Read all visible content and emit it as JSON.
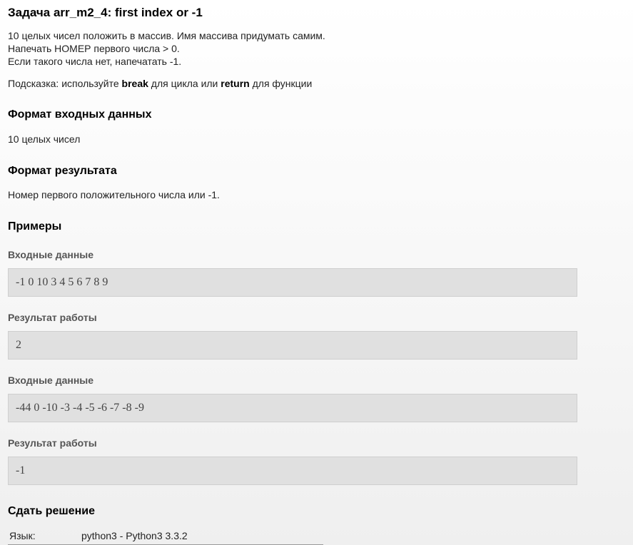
{
  "task": {
    "title": "Задача arr_m2_4: first index or -1",
    "statement_lines": [
      "10 целых чисел положить в массив. Имя массива придумать самим.",
      "Напечать НОМЕР первого числа > 0.",
      "Если такого числа нет, напечатать -1."
    ],
    "hint": {
      "prefix": "Подсказка: используйте ",
      "keyword1": "break",
      "middle": " для цикла или ",
      "keyword2": "return",
      "suffix": " для функции"
    }
  },
  "input_format": {
    "title": "Формат входных данных",
    "text": "10 целых чисел"
  },
  "output_format": {
    "title": "Формат результата",
    "text": "Номер первого положительного числа или -1."
  },
  "examples": {
    "title": "Примеры",
    "items": [
      {
        "input_label": "Входные данные",
        "input": "-1 0 10 3 4 5 6 7 8 9",
        "output_label": "Результат работы",
        "output": "2"
      },
      {
        "input_label": "Входные данные",
        "input": "-44 0 -10 -3 -4 -5 -6 -7 -8 -9",
        "output_label": "Результат работы",
        "output": "-1"
      }
    ]
  },
  "submit": {
    "title": "Сдать решение",
    "language_label": "Язык:",
    "language_value": "python3 - Python3 3.3.2"
  }
}
